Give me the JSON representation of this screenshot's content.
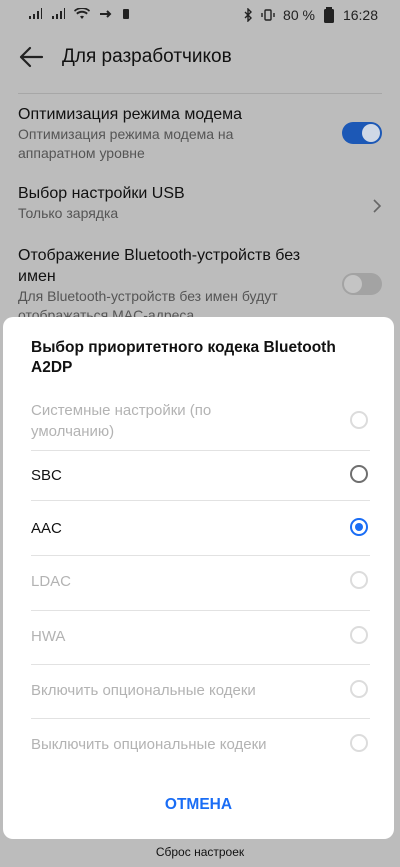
{
  "status_bar": {
    "battery": "80 %",
    "time": "16:28"
  },
  "appbar": {
    "title": "Для разработчиков"
  },
  "settings": {
    "modem": {
      "title": "Оптимизация режима модема",
      "subtitle_line1": "Оптимизация режима модема на",
      "subtitle_line2": "аппаратном уровне",
      "enabled": true
    },
    "usb": {
      "title": "Выбор настройки USB",
      "subtitle": "Только зарядка"
    },
    "bt_names": {
      "title_line1": "Отображение Bluetooth-устройств без",
      "title_line2": "имен",
      "subtitle_line1": "Для Bluetooth-устройств без имен будут",
      "subtitle_line2": "отображаться MAC-адреса",
      "enabled": false
    }
  },
  "dialog": {
    "title_line1": "Выбор приоритетного кодека Bluetooth",
    "title_line2": "A2DP",
    "options": [
      {
        "label_line1": "Системные настройки (по",
        "label_line2": "умолчанию)",
        "state": "disabled"
      },
      {
        "label_line1": "SBC",
        "state": "enabled"
      },
      {
        "label_line1": "AAC",
        "state": "selected"
      },
      {
        "label_line1": "LDAC",
        "state": "disabled"
      },
      {
        "label_line1": "HWA",
        "state": "disabled"
      },
      {
        "label_line1": "Включить опциональные кодеки",
        "state": "disabled"
      },
      {
        "label_line1": "Выключить опциональные кодеки",
        "state": "disabled"
      }
    ],
    "cancel_label": "ОТМЕНА"
  },
  "bottom": {
    "reset_label": "Сброс настроек"
  },
  "colors": {
    "accent": "#1a6df5",
    "scrim": "#bcbcbc",
    "dialog_bg": "#ffffff"
  }
}
